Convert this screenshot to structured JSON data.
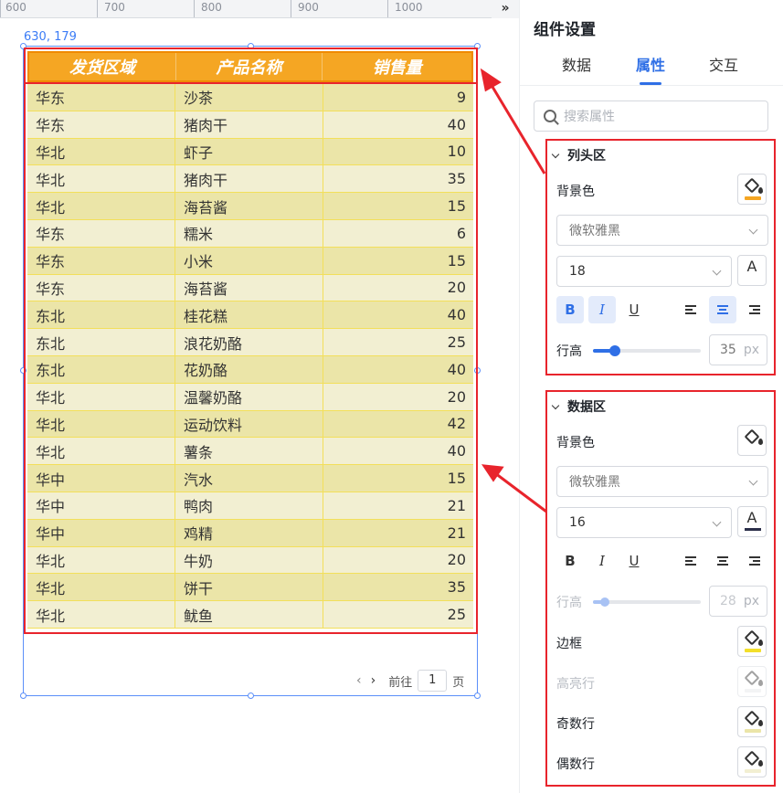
{
  "ruler": {
    "marks": [
      "600",
      "700",
      "800",
      "900",
      "1000"
    ],
    "more_icon": "double-chevron-right-icon"
  },
  "canvas": {
    "coords": "630, 179"
  },
  "table": {
    "headers": [
      "发货区域",
      "产品名称",
      "销售量"
    ],
    "rows": [
      [
        "华东",
        "沙茶",
        "9"
      ],
      [
        "华东",
        "猪肉干",
        "40"
      ],
      [
        "华北",
        "虾子",
        "10"
      ],
      [
        "华北",
        "猪肉干",
        "35"
      ],
      [
        "华北",
        "海苔酱",
        "15"
      ],
      [
        "华东",
        "糯米",
        "6"
      ],
      [
        "华东",
        "小米",
        "15"
      ],
      [
        "华东",
        "海苔酱",
        "20"
      ],
      [
        "东北",
        "桂花糕",
        "40"
      ],
      [
        "东北",
        "浪花奶酪",
        "25"
      ],
      [
        "东北",
        "花奶酪",
        "40"
      ],
      [
        "华北",
        "温馨奶酪",
        "20"
      ],
      [
        "华北",
        "运动饮料",
        "42"
      ],
      [
        "华北",
        "薯条",
        "40"
      ],
      [
        "华中",
        "汽水",
        "15"
      ],
      [
        "华中",
        "鸭肉",
        "21"
      ],
      [
        "华中",
        "鸡精",
        "21"
      ],
      [
        "华北",
        "牛奶",
        "20"
      ],
      [
        "华北",
        "饼干",
        "35"
      ],
      [
        "华北",
        "鱿鱼",
        "25"
      ]
    ]
  },
  "pager": {
    "prev": "‹",
    "next": "›",
    "goto": "前往",
    "page": "1",
    "suffix": "页"
  },
  "panel": {
    "title": "组件设置",
    "tabs": [
      "数据",
      "属性",
      "交互"
    ],
    "active_tab": "属性",
    "search_placeholder": "搜索属性",
    "header_section": {
      "title": "列头区",
      "bg_label": "背景色",
      "bg_color": "#f5a623",
      "font_family": "微软雅黑",
      "font_size": "18",
      "font_color_icon": "A",
      "bold": "B",
      "italic": "I",
      "underline": "U",
      "line_height_label": "行高",
      "line_height": "35",
      "unit": "px"
    },
    "data_section": {
      "title": "数据区",
      "bg_label": "背景色",
      "font_family": "微软雅黑",
      "font_size": "16",
      "font_color_icon": "A",
      "font_color": "#2b2f4a",
      "bold": "B",
      "italic": "I",
      "underline": "U",
      "line_height_label": "行高",
      "line_height": "28",
      "unit": "px",
      "border_label": "边框",
      "border_color": "#f3df2a",
      "highlight_label": "高亮行",
      "odd_label": "奇数行",
      "odd_color": "#ebe5a8",
      "even_label": "偶数行",
      "even_color": "#f2efd2"
    }
  }
}
